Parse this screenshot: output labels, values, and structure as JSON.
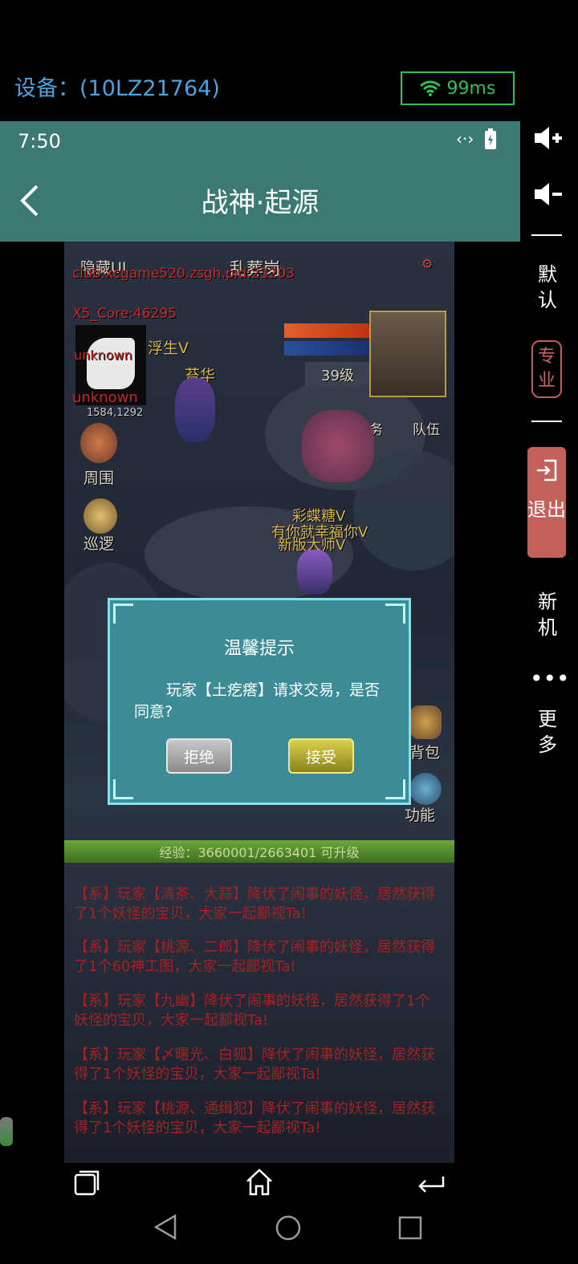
{
  "top_bar": {
    "device": "设备：(10LZ21764)",
    "ping": "99ms"
  },
  "status_bar": {
    "time": "7:50"
  },
  "header": {
    "title": "战神·起源"
  },
  "game": {
    "hide_ui": "隐藏UI",
    "map_name": "乱葬岗",
    "watermark": "club.xcgame520.zsgh.pid:21203",
    "core": "X5_Core:46295",
    "minimap_red": "unknown",
    "minimap_red2": "unknown",
    "coords": "1584,1292",
    "player1": "浮生V",
    "player2": "苔华",
    "level": "39级",
    "task": "任务",
    "team": "队伍",
    "surround": "周围",
    "patrol": "巡逻",
    "npc1": "彩蝶糖V",
    "npc2": "有你就幸福你V",
    "npc3": "新版大师V",
    "bag": "背包",
    "function": "功能"
  },
  "dialog": {
    "title": "温馨提示",
    "message": "玩家【土疙瘩】请求交易，是否同意?",
    "reject": "拒绝",
    "accept": "接受"
  },
  "exp_bar": {
    "text": "经验：3660001/2663401  可升级"
  },
  "chat": {
    "lines": [
      "【系】玩家【清茶、大蒜】降伏了闹事的妖怪，居然获得了1个妖怪的宝贝，大家一起鄙视Ta!",
      "【系】玩家【桃源、二郎】降伏了闹事的妖怪，居然获得了1个60神工图，大家一起鄙视Ta!",
      "【系】玩家【九幽】降伏了闹事的妖怪，居然获得了1个妖怪的宝贝，大家一起鄙视Ta!",
      "【系】玩家【〆曙光、白狐】降伏了闹事的妖怪，居然获得了1个妖怪的宝贝，大家一起鄙视Ta!",
      "【系】玩家【桃源、通缉犯】降伏了闹事的妖怪，居然获得了1个妖怪的宝贝，大家一起鄙视Ta!"
    ]
  },
  "right_rail": {
    "default": "默认",
    "pro": "专业",
    "exit": "退出",
    "new_device": "新机",
    "more": "更多"
  },
  "icons": [
    "wifi-icon",
    "volume-up-icon",
    "volume-down-icon",
    "back-arrow-icon",
    "battery-icon",
    "exit-icon",
    "more-icon",
    "home-icon",
    "recent-apps-icon",
    "return-icon",
    "nav-back-icon",
    "nav-home-icon",
    "nav-recents-icon"
  ]
}
